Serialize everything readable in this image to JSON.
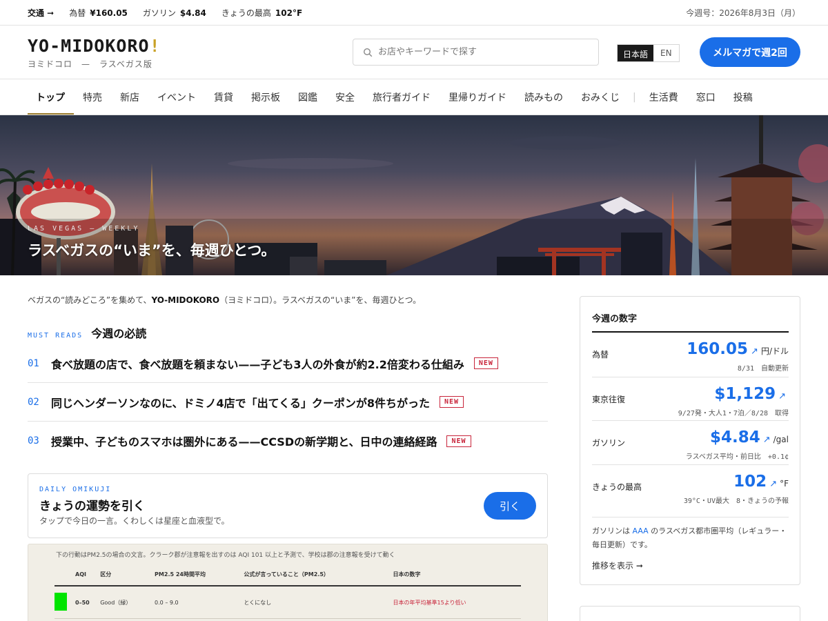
{
  "topbar": {
    "traffic": "交通 ➞",
    "fx_label": "為替",
    "fx_value": "¥160.05",
    "gas_label": "ガソリン",
    "gas_value": "$4.84",
    "high_label": "きょうの最高",
    "high_value": "102°F",
    "issue": "今週号：2026年8月3日（月）"
  },
  "header": {
    "logo_text": "YO-MIDOKORO",
    "logo_bang": "!",
    "logo_sub": "ヨミドコロ　—　ラスベガス版",
    "search_placeholder": "お店やキーワードで探す",
    "lang_ja": "日本語",
    "lang_en": "EN",
    "cta": "メルマガで週2回"
  },
  "nav": {
    "items": [
      "トップ",
      "特売",
      "新店",
      "イベント",
      "賃貸",
      "掲示板",
      "図鑑",
      "安全",
      "旅行者ガイド",
      "里帰りガイド",
      "読みもの",
      "おみくじ"
    ],
    "items_secondary": [
      "生活費",
      "窓口",
      "投稿"
    ],
    "active": "トップ"
  },
  "hero": {
    "kicker": "LAS VEGAS — WEEKLY",
    "headline": "ラスベガスの“いま”を、毎週ひとつ。"
  },
  "intro": {
    "before": "ベガスの“読みどころ”を集めて、",
    "brand": "YO-MIDOKORO",
    "after": "（ヨミドコロ）。ラスベガスの“いま”を、毎週ひとつ。"
  },
  "must_reads": {
    "label_en": "MUST READS",
    "label_jp": "今週の必読",
    "items": [
      {
        "num": "01",
        "title": "食べ放題の店で、食べ放題を頼まない——子ども3人の外食が約2.2倍変わる仕組み",
        "badge": "NEW"
      },
      {
        "num": "02",
        "title": "同じヘンダーソンなのに、ドミノ4店で「出てくる」クーポンが8件ちがった",
        "badge": "NEW"
      },
      {
        "num": "03",
        "title": "授業中、子どものスマホは圏外にある——CCSDの新学期と、日中の連絡経路",
        "badge": "NEW"
      }
    ]
  },
  "omikuji": {
    "label_en": "DAILY OMIKUJI",
    "title": "きょうの運勢を引く",
    "sub": "タップで今日の一言。くわしくは星座と血液型で。",
    "button": "引く"
  },
  "aqi": {
    "note": "下の行動はPM2.5の場合の文言。クラーク郡が注意報を出すのは AQI 101 以上と予測で、学校は郡の注意報を受けて動く",
    "headers": [
      "AQI",
      "区分",
      "PM2.5 24時間平均",
      "公式が言っていること（PM2.5）",
      "日本の数字"
    ],
    "rows": [
      {
        "color": "#00e400",
        "aqi": "0–50",
        "cat": "Good（緑）",
        "pm": "0.0 – 9.0",
        "official": "とくになし",
        "japan": "日本の年平均基準15より低い"
      }
    ]
  },
  "sidebar": {
    "title": "今週の数字",
    "stats": [
      {
        "label": "為替",
        "value": "160.05",
        "arrow": "↗",
        "unit": "円/ドル",
        "meta": "8/31　自動更新"
      },
      {
        "label": "東京往復",
        "value": "$1,129",
        "arrow": "↗",
        "unit": "",
        "meta": "9/27発・大人1・7泊／8/28　取得"
      },
      {
        "label": "ガソリン",
        "value": "$4.84",
        "arrow": "↗",
        "unit": "/gal",
        "meta": "ラスベガス平均・前日比　+0.1¢"
      },
      {
        "label": "きょうの最高",
        "value": "102",
        "arrow": "↗",
        "unit": "°F",
        "meta": "39°C・UV最大　8・きょうの予報"
      }
    ],
    "foot_before": "ガソリンは ",
    "foot_link": "AAA",
    "foot_after": " のラスベガス都市圏平均（レギュラー・毎日更新）です。",
    "more": "推移を表示 ➞"
  },
  "colors": {
    "accent": "#1a6ee8",
    "new_badge": "#c8243a",
    "gold": "#c9a227"
  }
}
